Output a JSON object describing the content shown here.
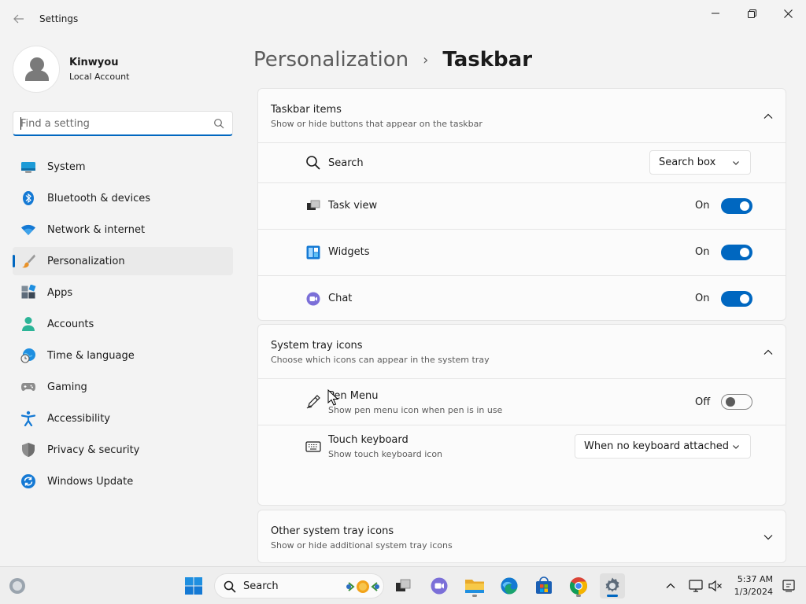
{
  "window": {
    "title": "Settings"
  },
  "profile": {
    "name": "Kinwyou",
    "account_type": "Local Account"
  },
  "search": {
    "placeholder": "Find a setting"
  },
  "sidebar": {
    "items": [
      {
        "label": "System",
        "icon": "system-icon",
        "active": false
      },
      {
        "label": "Bluetooth & devices",
        "icon": "bluetooth-icon",
        "active": false
      },
      {
        "label": "Network & internet",
        "icon": "wifi-icon",
        "active": false
      },
      {
        "label": "Personalization",
        "icon": "paintbrush-icon",
        "active": true
      },
      {
        "label": "Apps",
        "icon": "apps-icon",
        "active": false
      },
      {
        "label": "Accounts",
        "icon": "accounts-icon",
        "active": false
      },
      {
        "label": "Time & language",
        "icon": "globe-clock-icon",
        "active": false
      },
      {
        "label": "Gaming",
        "icon": "gamepad-icon",
        "active": false
      },
      {
        "label": "Accessibility",
        "icon": "accessibility-icon",
        "active": false
      },
      {
        "label": "Privacy & security",
        "icon": "shield-icon",
        "active": false
      },
      {
        "label": "Windows Update",
        "icon": "windows-update-icon",
        "active": false
      }
    ]
  },
  "breadcrumb": {
    "parent": "Personalization",
    "separator": "›",
    "current": "Taskbar"
  },
  "taskbar_items": {
    "title": "Taskbar items",
    "subtitle": "Show or hide buttons that appear on the taskbar",
    "rows": [
      {
        "label": "Search",
        "control": "dropdown",
        "value": "Search box",
        "icon": "search-icon"
      },
      {
        "label": "Task view",
        "control": "toggle",
        "state_label": "On",
        "on": true,
        "icon": "task-view-icon"
      },
      {
        "label": "Widgets",
        "control": "toggle",
        "state_label": "On",
        "on": true,
        "icon": "widgets-icon"
      },
      {
        "label": "Chat",
        "control": "toggle",
        "state_label": "On",
        "on": true,
        "icon": "chat-icon"
      }
    ]
  },
  "system_tray": {
    "title": "System tray icons",
    "subtitle": "Choose which icons can appear in the system tray",
    "rows": [
      {
        "label": "Pen Menu",
        "sublabel": "Show pen menu icon when pen is in use",
        "control": "toggle",
        "state_label": "Off",
        "on": false,
        "icon": "pen-icon"
      },
      {
        "label": "Touch keyboard",
        "sublabel": "Show touch keyboard icon",
        "control": "dropdown",
        "value": "When no keyboard attached",
        "icon": "keyboard-icon"
      }
    ]
  },
  "other_tray": {
    "title": "Other system tray icons",
    "subtitle": "Show or hide additional system tray icons"
  },
  "taskbar": {
    "search_label": "Search",
    "time": "5:37 AM",
    "date": "1/3/2024"
  },
  "colors": {
    "accent": "#0067c0",
    "background": "#f3f3f3",
    "card": "#fbfbfb"
  }
}
